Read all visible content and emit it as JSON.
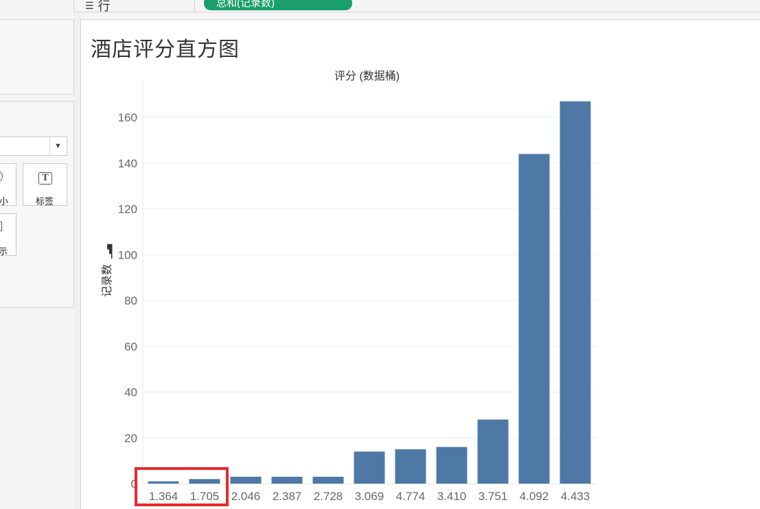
{
  "shelf": {
    "rows_label": "行",
    "pill_label": "总和(记录数)"
  },
  "marks_panel": {
    "size_label": "小",
    "label_label": "标签",
    "tooltip_label": "提示"
  },
  "icons": {
    "rows_icon": "lines-icon",
    "dropdown_icon": "chevron-down-icon",
    "label_icon": "text-T-icon",
    "sort_icon": "bar-sort-icon"
  },
  "colors": {
    "bar": "#4e79a7",
    "pill": "#1a9e6b",
    "highlight": "#e8282d"
  },
  "chart_data": {
    "type": "bar",
    "title": "酒店评分直方图",
    "xlabel": "评分 (数据桶)",
    "ylabel": "记录数",
    "categories": [
      "1.364",
      "1.705",
      "2.046",
      "2.387",
      "2.728",
      "3.069",
      "4.774",
      "3.410",
      "3.751",
      "4.092",
      "4.433"
    ],
    "values": [
      1,
      2,
      3,
      3,
      3,
      14,
      15,
      16,
      28,
      144,
      167
    ],
    "yticks": [
      0,
      20,
      40,
      60,
      80,
      100,
      120,
      140,
      160
    ],
    "ylim": [
      0,
      167
    ],
    "grid": true,
    "highlighted_categories": [
      "1.364",
      "1.705"
    ]
  }
}
